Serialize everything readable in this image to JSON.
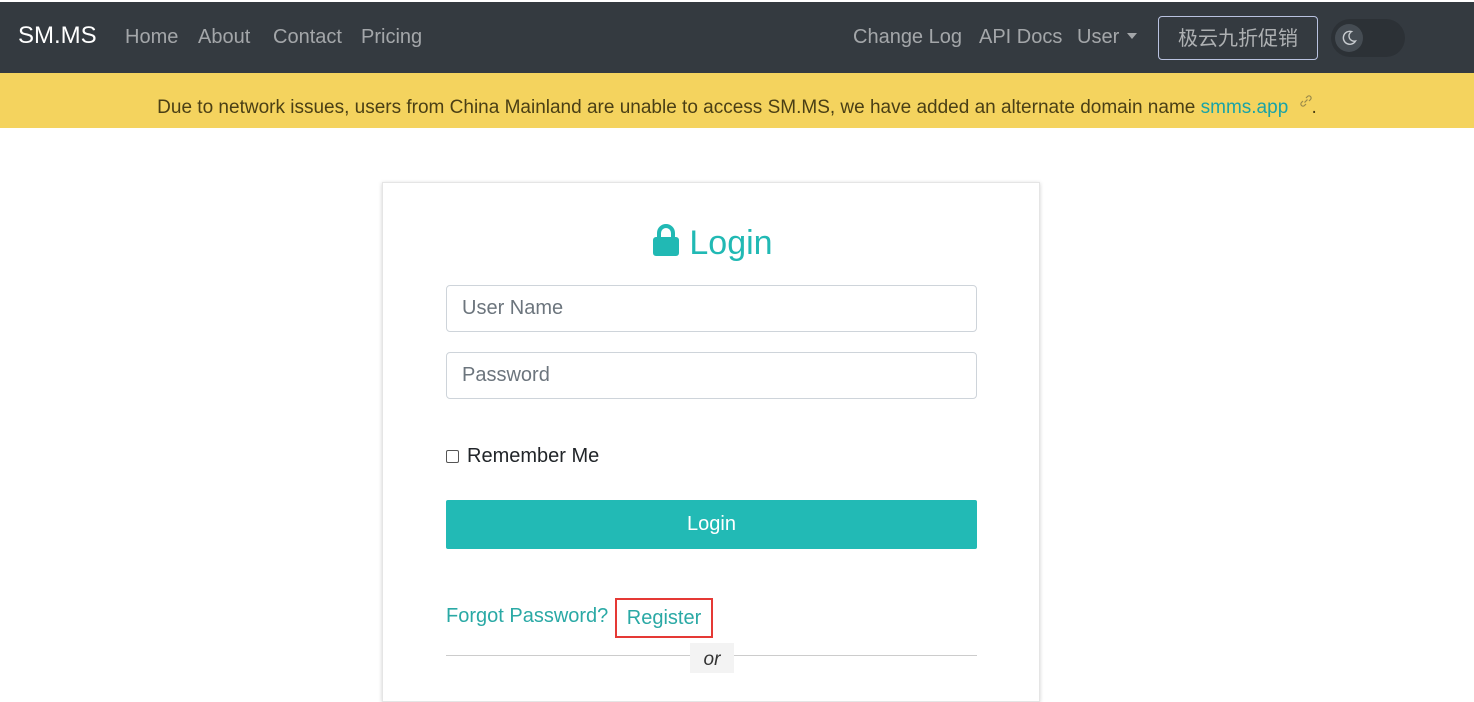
{
  "navbar": {
    "brand": "SM.MS",
    "left_links": [
      "Home",
      "About",
      "Contact",
      "Pricing"
    ],
    "right_links": [
      "Change Log",
      "API Docs"
    ],
    "user_menu": "User",
    "promo_button": "极云九折促销",
    "theme_toggle_icon": "moon-icon"
  },
  "alert": {
    "message": "Due to network issues, users from China Mainland are unable to access SM.MS, we have added an alternate domain name",
    "link_text": "smms.app",
    "suffix": ".",
    "link_icon": "external-link-icon"
  },
  "login": {
    "title": "Login",
    "title_icon": "lock-icon",
    "username_placeholder": "User Name",
    "password_placeholder": "Password",
    "remember_label": "Remember Me",
    "submit_label": "Login",
    "forgot_label": "Forgot Password?",
    "register_label": "Register",
    "or_label": "or"
  },
  "colors": {
    "navbar_bg": "#343a40",
    "alert_bg": "#f4d35e",
    "accent": "#22bab5",
    "highlight": "#e53935"
  }
}
